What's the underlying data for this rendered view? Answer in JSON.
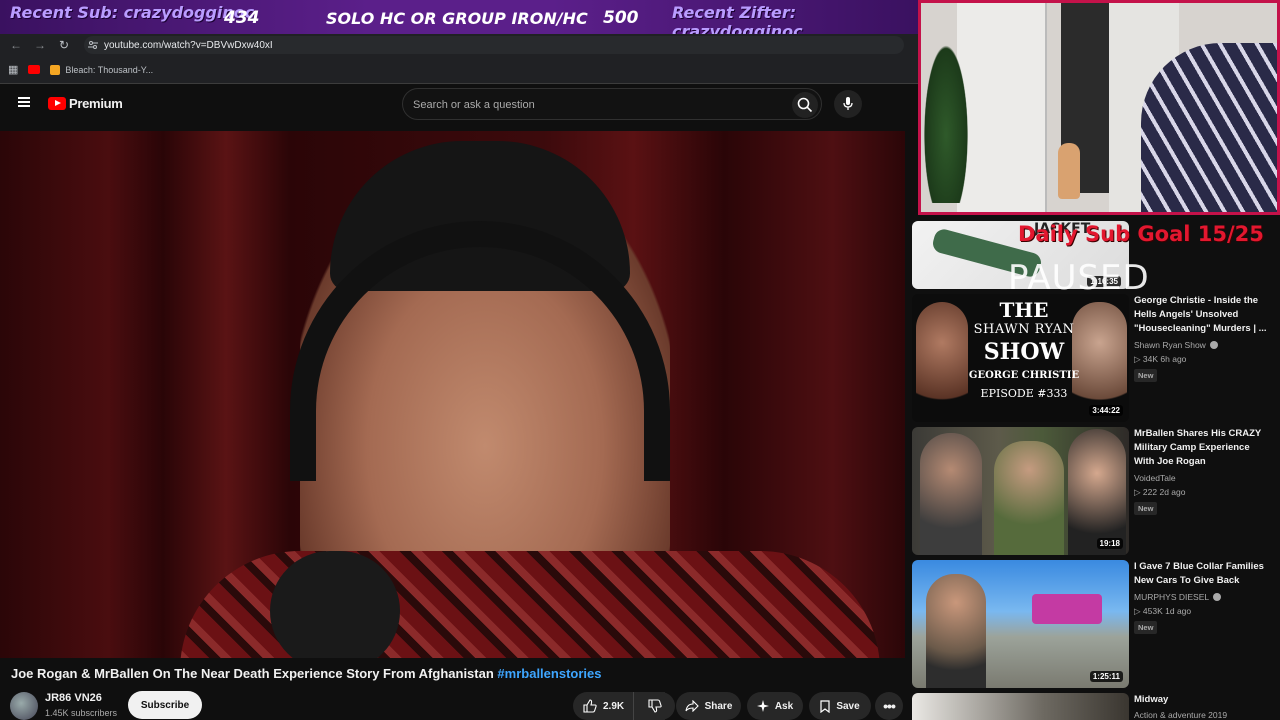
{
  "overlay": {
    "recent_sub": "Recent Sub: crazydogginoc",
    "count_left": "434",
    "goal_text": "SOLO HC OR GROUP IRON/HC",
    "count_right": "500",
    "recent_zifter": "Recent Zifter: crazydogginoc",
    "daily_goal": "Daily Sub Goal 15/25",
    "paused": "PAUSED"
  },
  "browser": {
    "url": "youtube.com/watch?v=DBVwDxw40xI",
    "bookmark_label": "Bleach: Thousand-Y..."
  },
  "youtube": {
    "logo_text": "Premium",
    "search_placeholder": "Search or ask a question"
  },
  "video": {
    "title": "Joe Rogan & MrBallen On The Near Death Experience Story From Afghanistan",
    "hashtag": "#mrballenstories",
    "channel_name": "JR86 VN26",
    "subscribers": "1.45K subscribers",
    "subscribe_label": "Subscribe",
    "likes": "2.9K",
    "share_label": "Share",
    "ask_label": "Ask",
    "save_label": "Save"
  },
  "recommendations": [
    {
      "thumb_text": "JACKET",
      "duration": "1:16:35"
    },
    {
      "title": "George Christie - Inside the Hells Angels' Unsolved \"Housecleaning\" Murders | ...",
      "channel": "Shawn Ryan Show",
      "meta": "34K  6h ago",
      "badge": "New",
      "duration": "3:44:22",
      "thumb_line1": "THE",
      "thumb_line2": "SHAWN RYAN",
      "thumb_line3": "SHOW",
      "thumb_line4": "GEORGE CHRISTIE",
      "thumb_line5": "EPISODE #333"
    },
    {
      "title": "MrBallen Shares His CRAZY Military Camp Experience With Joe Rogan",
      "channel": "VoidedTale",
      "meta": "222  2d ago",
      "badge": "New",
      "duration": "19:18"
    },
    {
      "title": "I Gave 7 Blue Collar Families New Cars To Give Back",
      "channel": "MURPHYS DIESEL",
      "meta": "453K  1d ago",
      "badge": "New",
      "duration": "1:25:11"
    },
    {
      "title": "Midway",
      "channel": "Action & adventure 2019"
    }
  ]
}
